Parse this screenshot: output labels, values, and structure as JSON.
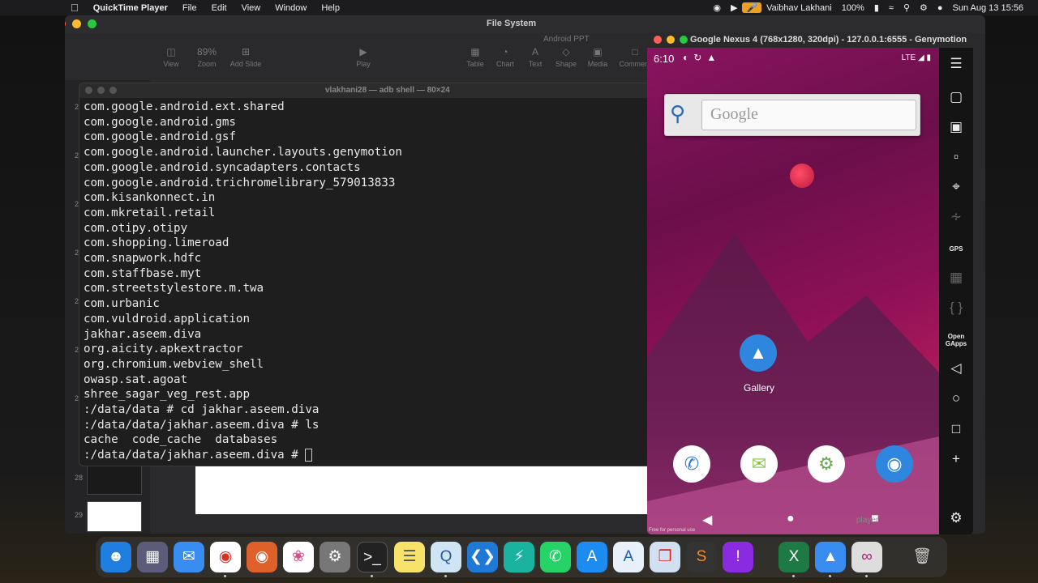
{
  "menubar": {
    "apple": "",
    "app_name": "QuickTime Player",
    "menus": [
      "File",
      "Edit",
      "View",
      "Window",
      "Help"
    ],
    "user": "Vaibhav Lakhani",
    "battery": "100%",
    "datetime": "Sun Aug 13  15:56"
  },
  "keynote": {
    "doc_title": "File System",
    "sub_title": "Android PPT",
    "toolbar": {
      "zoom_value": "89%",
      "view": "View",
      "zoom": "Zoom",
      "add_slide": "Add Slide",
      "play": "Play",
      "table": "Table",
      "chart": "Chart",
      "text": "Text",
      "shape": "Shape",
      "media": "Media",
      "comment": "Comment"
    },
    "slide_numbers": [
      "2",
      "2",
      "2",
      "2",
      "2",
      "2",
      "2",
      "28",
      "29"
    ]
  },
  "terminal": {
    "title": "vlakhani28 — adb shell — 80×24",
    "lines": [
      "com.google.android.ext.shared",
      "com.google.android.gms",
      "com.google.android.gsf",
      "com.google.android.launcher.layouts.genymotion",
      "com.google.android.syncadapters.contacts",
      "com.google.android.trichromelibrary_579013833",
      "com.kisankonnect.in",
      "com.mkretail.retail",
      "com.otipy.otipy",
      "com.shopping.limeroad",
      "com.snapwork.hdfc",
      "com.staffbase.myt",
      "com.streetstylestore.m.twa",
      "com.urbanic",
      "com.vuldroid.application",
      "jakhar.aseem.diva",
      "org.aicity.apkextractor",
      "org.chromium.webview_shell",
      "owasp.sat.agoat",
      "shree_sagar_veg_rest.app",
      ":/data/data # cd jakhar.aseem.diva",
      ":/data/data/jakhar.aseem.diva # ls",
      "cache  code_cache  databases"
    ],
    "prompt": ":/data/data/jakhar.aseem.diva # "
  },
  "genymotion": {
    "title": "Google Nexus 4 (768x1280, 320dpi) - 127.0.0.1:6555 - Genymotion",
    "phone": {
      "time": "6:10",
      "network": "LTE",
      "search_placeholder": "Google",
      "gallery_label": "Gallery",
      "watermark": "Free for personal use",
      "player_label": "player"
    },
    "tools": {
      "gps": "GPS",
      "open_gapps": "Open GApps"
    }
  }
}
